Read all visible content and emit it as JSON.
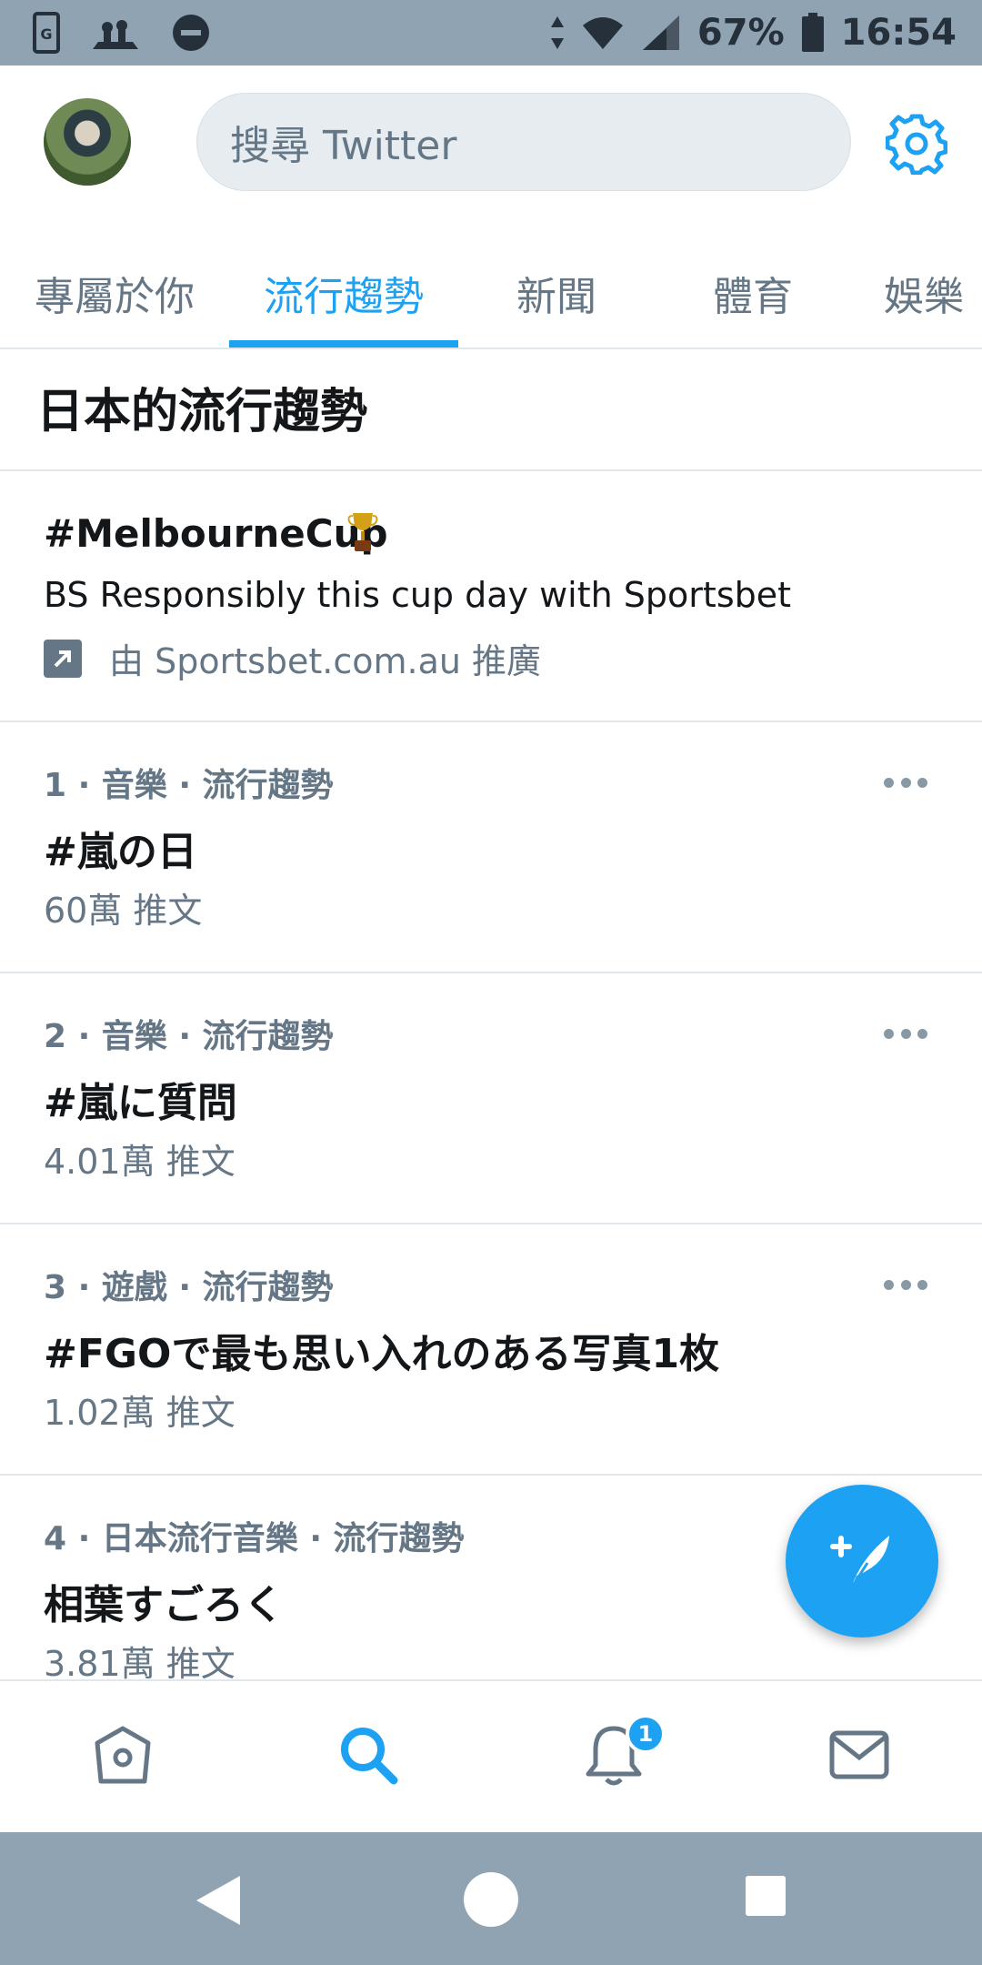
{
  "status_bar": {
    "battery": "67%",
    "time": "16:54",
    "icons": [
      "screenshot-icon",
      "photo-icon",
      "do-not-disturb-icon",
      "data-arrows-icon",
      "wifi-icon",
      "signal-icon",
      "battery-icon"
    ]
  },
  "header": {
    "search_placeholder": "搜尋 Twitter",
    "icons": [
      "avatar",
      "gear-icon"
    ]
  },
  "tabs": [
    {
      "label": "專屬於你",
      "active": false
    },
    {
      "label": "流行趨勢",
      "active": true
    },
    {
      "label": "新聞",
      "active": false
    },
    {
      "label": "體育",
      "active": false
    },
    {
      "label": "娛樂",
      "active": false
    }
  ],
  "section_title": "日本的流行趨勢",
  "promoted": {
    "title": "#MelbourneCup",
    "description": "BS Responsibly this cup day with Sportsbet",
    "promoted_by": "由 Sportsbet.com.au 推廣"
  },
  "trends": [
    {
      "meta": "1 · 音樂 · 流行趨勢",
      "name": "#嵐の日",
      "count": "60萬 推文"
    },
    {
      "meta": "2 · 音樂 · 流行趨勢",
      "name": "#嵐に質問",
      "count": "4.01萬 推文"
    },
    {
      "meta": "3 · 遊戲 · 流行趨勢",
      "name": "#FGOで最も思い入れのある写真1枚",
      "count": "1.02萬 推文"
    },
    {
      "meta": "4 · 日本流行音樂 · 流行趨勢",
      "name": "相葉すごろく",
      "count": "3.81萬 推文"
    }
  ],
  "bottom_nav": {
    "items": [
      "home-icon",
      "search-icon",
      "notifications-icon",
      "messages-icon"
    ],
    "notification_badge": "1"
  },
  "colors": {
    "accent": "#1da1f2",
    "status_bar": "#8fa3b2",
    "secondary_text": "#657786"
  }
}
